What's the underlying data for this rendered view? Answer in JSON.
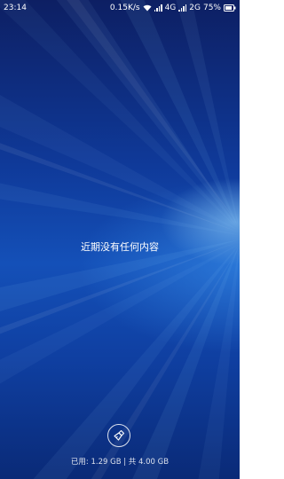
{
  "status": {
    "time": "23:14",
    "speed": "0.15K/s",
    "net1": "4G",
    "net2": "2G",
    "battery": "75%"
  },
  "main": {
    "empty_message": "近期没有任何内容"
  },
  "footer": {
    "memory_label": "已用: 1.29 GB | 共 4.00 GB"
  },
  "icons": {
    "clear": "broom-icon",
    "wifi": "wifi-icon",
    "battery": "battery-icon"
  }
}
